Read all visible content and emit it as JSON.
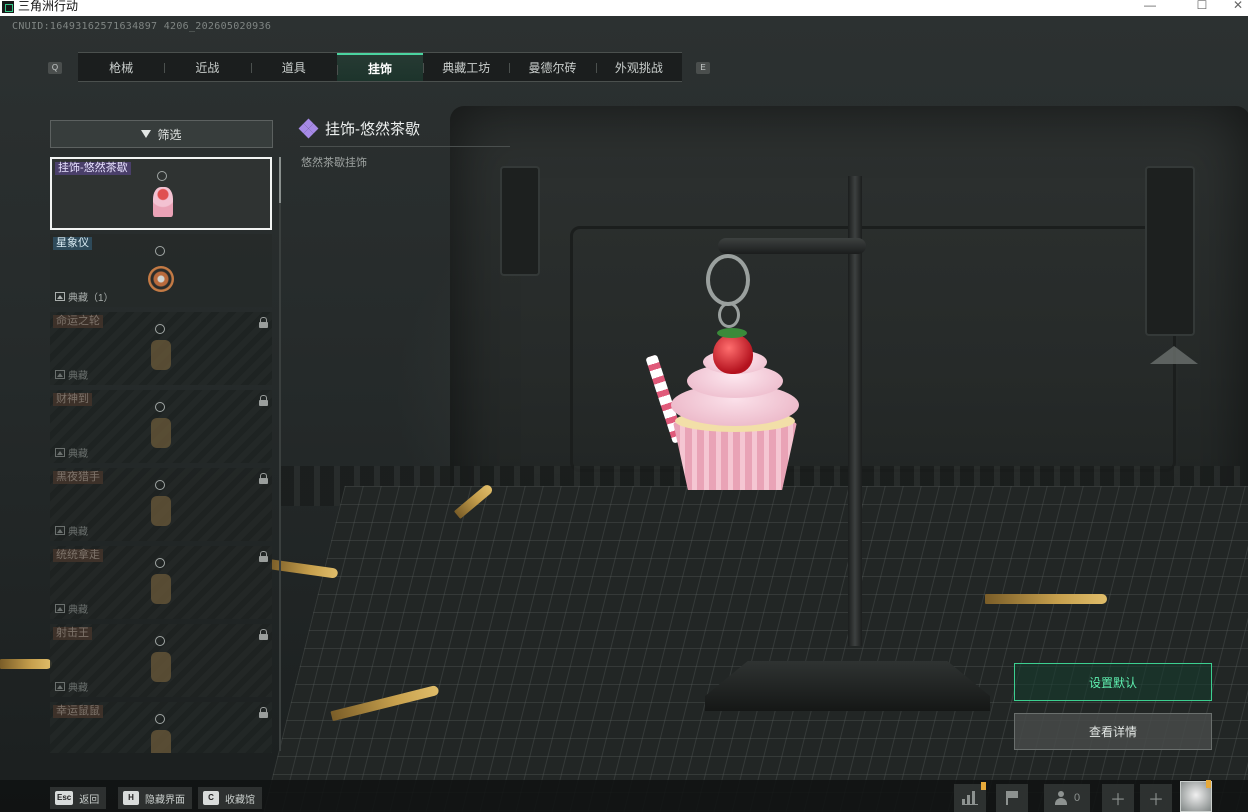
{
  "window": {
    "title": "三角洲行动",
    "minimize": "—",
    "maximize": "☐",
    "close": "✕"
  },
  "uid": "CNUID:16493162571634897 4206_202605020936",
  "tabs": {
    "left_key": "Q",
    "right_key": "E",
    "items": [
      {
        "label": "枪械",
        "active": false
      },
      {
        "label": "近战",
        "active": false
      },
      {
        "label": "道具",
        "active": false
      },
      {
        "label": "挂饰",
        "active": true
      },
      {
        "label": "典藏工坊",
        "active": false
      },
      {
        "label": "曼德尔砖",
        "active": false
      },
      {
        "label": "外观挑战",
        "active": false
      }
    ]
  },
  "filter": {
    "label": "筛选"
  },
  "items": [
    {
      "name": "挂饰-悠然茶歇",
      "state": "selected",
      "thumb": "cupcake",
      "collect": ""
    },
    {
      "name": "星象仪",
      "state": "normal",
      "thumb": "astrolabe",
      "collect": "典藏（1）"
    },
    {
      "name": "命运之轮",
      "state": "locked",
      "thumb": "charm",
      "collect": "典藏"
    },
    {
      "name": "财神到",
      "state": "locked",
      "thumb": "charm",
      "collect": "典藏"
    },
    {
      "name": "黑夜猎手",
      "state": "locked",
      "thumb": "charm",
      "collect": "典藏"
    },
    {
      "name": "统统拿走",
      "state": "locked",
      "thumb": "charm",
      "collect": "典藏"
    },
    {
      "name": "射击王",
      "state": "locked",
      "thumb": "charm",
      "collect": "典藏"
    },
    {
      "name": "幸运鼠鼠",
      "state": "locked",
      "thumb": "charm",
      "collect": ""
    }
  ],
  "detail": {
    "title": "挂饰-悠然茶歇",
    "description": "悠然茶歇挂饰",
    "rarity_color": "#a68ae6"
  },
  "actions": {
    "set_default": "设置默认",
    "view_details": "查看详情"
  },
  "bottom_hints": [
    {
      "key": "Esc",
      "label": "返回"
    },
    {
      "key": "H",
      "label": "隐藏界面"
    },
    {
      "key": "C",
      "label": "收藏馆"
    }
  ],
  "bottom_right": {
    "friends_count": "0",
    "icons": [
      "stats-icon",
      "flag-icon",
      "friends-icon",
      "plus-icon",
      "plus-icon",
      "avatar"
    ]
  },
  "colors": {
    "accent": "#3ccf90",
    "tab_active": "#4bd4a0",
    "locked_badge": "#3d3129",
    "owned_badge": "#2e4a5a",
    "selected_badge": "#4a3f6a"
  }
}
